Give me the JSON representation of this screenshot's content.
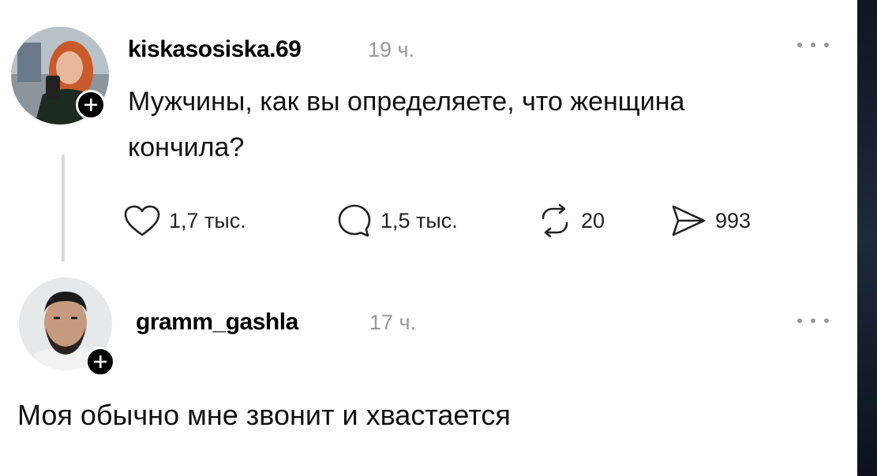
{
  "posts": [
    {
      "username": "kiskasosiska.69",
      "time": "19 ч.",
      "text_line1": "Мужчины, как вы определяете, что женщина",
      "text_line2": "кончила?",
      "likes": "1,7 тыс.",
      "comments": "1,5 тыс.",
      "reposts": "20",
      "shares": "993"
    },
    {
      "username": "gramm_gashla",
      "time": "17 ч.",
      "text": "Моя обычно мне звонит и хвастается"
    }
  ],
  "icons": {
    "like": "heart-icon",
    "comment": "speech-bubble-icon",
    "repost": "repost-icon",
    "share": "send-icon",
    "follow": "plus-icon",
    "more": "more-dots-icon"
  },
  "colors": {
    "card_bg": "#ffffff",
    "text": "#111111",
    "muted": "#9a9a9a",
    "badge": "#000000",
    "thread_line": "#d9d9d9"
  }
}
